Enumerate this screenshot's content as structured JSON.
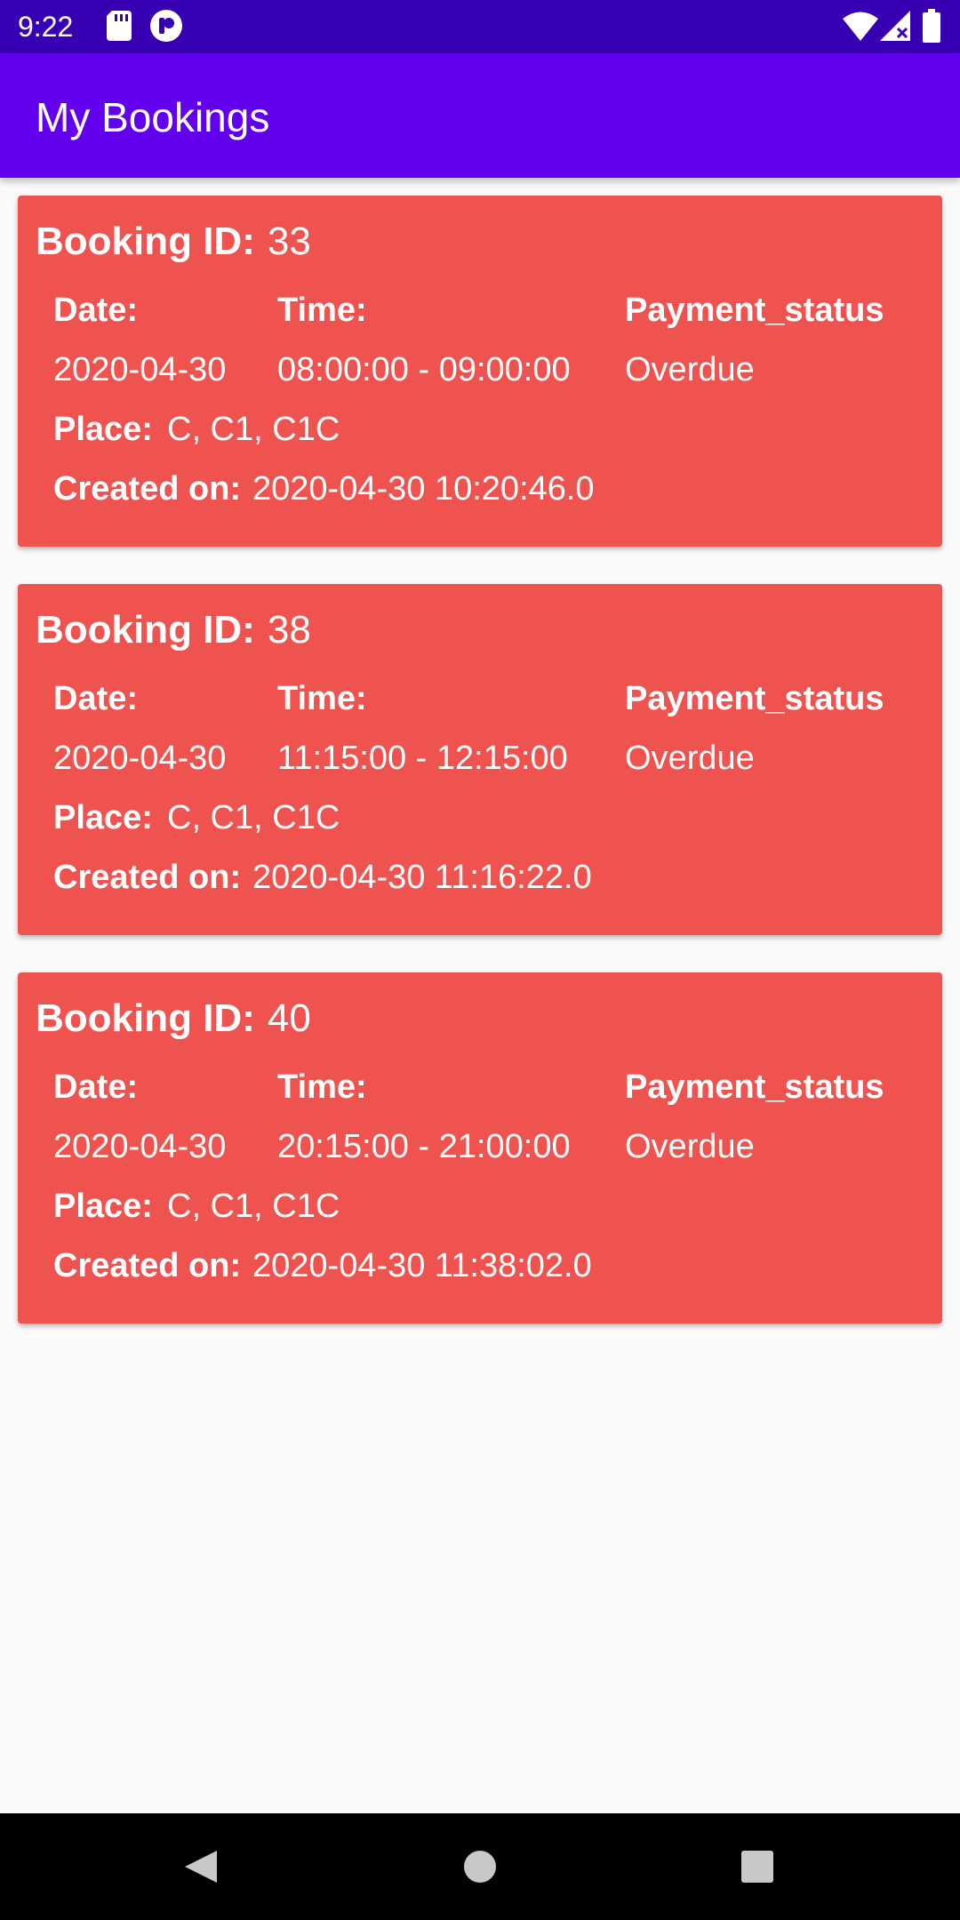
{
  "status_bar": {
    "time": "9:22",
    "icons": [
      "sd-card-icon",
      "app-notification-icon",
      "wifi-icon",
      "signal-icon",
      "battery-icon"
    ]
  },
  "app_bar": {
    "title": "My Bookings"
  },
  "labels": {
    "booking_id": "Booking ID:",
    "date": "Date:",
    "time": "Time:",
    "payment_status": "Payment_status",
    "place": "Place:",
    "created_on": "Created on:"
  },
  "bookings": [
    {
      "id": "33",
      "date": "2020-04-30",
      "time": "08:00:00 - 09:00:00",
      "payment_status": "Overdue",
      "place": "C, C1, C1C",
      "created_on": "2020-04-30 10:20:46.0"
    },
    {
      "id": "38",
      "date": "2020-04-30",
      "time": "11:15:00 - 12:15:00",
      "payment_status": "Overdue",
      "place": "C, C1, C1C",
      "created_on": "2020-04-30 11:16:22.0"
    },
    {
      "id": "40",
      "date": "2020-04-30",
      "time": "20:15:00 - 21:00:00",
      "payment_status": "Overdue",
      "place": "C, C1, C1C",
      "created_on": "2020-04-30 11:38:02.0"
    }
  ],
  "colors": {
    "status_bar": "#3700b3",
    "app_bar": "#6200ee",
    "card_overdue": "#ef5350",
    "background": "#fafafa",
    "nav_bar": "#000000"
  },
  "nav_bar": {
    "buttons": [
      "back-icon",
      "home-icon",
      "recents-icon"
    ]
  }
}
